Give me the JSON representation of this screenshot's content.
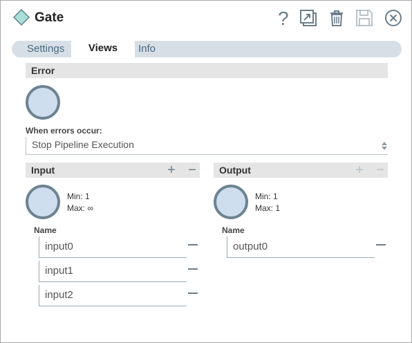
{
  "header": {
    "title": "Gate",
    "icons": [
      "diamond-icon",
      "help-icon",
      "export-icon",
      "trash-icon",
      "save-icon",
      "close-icon"
    ]
  },
  "tabs": [
    {
      "label": "Settings",
      "active": false
    },
    {
      "label": "Views",
      "active": true
    },
    {
      "label": "Info",
      "active": false
    }
  ],
  "error": {
    "title": "Error",
    "when_label": "When errors occur:",
    "selected": "Stop Pipeline Execution"
  },
  "input": {
    "title": "Input",
    "min": "Min: 1",
    "max": "Max: ∞",
    "name_label": "Name",
    "rows": [
      "input0",
      "input1",
      "input2"
    ]
  },
  "output": {
    "title": "Output",
    "min": "Min: 1",
    "max": "Max: 1",
    "name_label": "Name",
    "rows": [
      "output0"
    ]
  },
  "colors": {
    "accent": "#6e8391",
    "circle_fill": "#cfdeee",
    "section_bg": "#e5e5e5",
    "tab_bar": "#d7dfe6"
  }
}
